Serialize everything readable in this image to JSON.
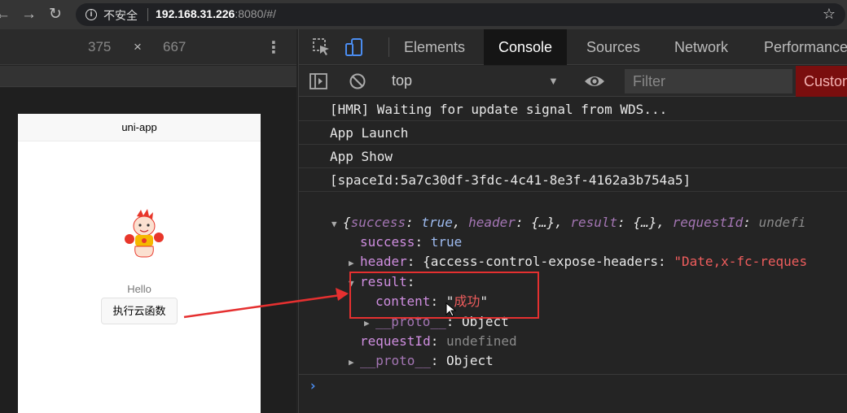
{
  "browser": {
    "back_icon": "back-arrow-icon",
    "forward_icon": "forward-arrow-icon",
    "reload_icon": "reload-icon",
    "security_label": "不安全",
    "url_host": "192.168.31.226",
    "url_rest": ":8080/#/",
    "bookmark_icon": "star-icon"
  },
  "device_toolbar": {
    "width": "375",
    "times": "×",
    "height": "667"
  },
  "phone": {
    "nav_title": "uni-app",
    "hello_text": "Hello",
    "button_label": "执行云函数"
  },
  "devtools": {
    "tabs": [
      "Elements",
      "Console",
      "Sources",
      "Network",
      "Performance"
    ],
    "active_tab": "Console",
    "context": "top",
    "filter_placeholder": "Filter",
    "levels_label": "Custom levels"
  },
  "console": {
    "logs": [
      "[HMR] Waiting for update signal from WDS...",
      "App Launch",
      "App Show",
      "[spaceId:5a7c30df-3fdc-4c41-8e3f-4162a3b754a5]"
    ],
    "object_preview": {
      "success_key": "success",
      "success_val": "true",
      "header_key": "header",
      "header_val": "{…}",
      "result_key": "result",
      "result_val": "{…}",
      "requestId_key": "requestId",
      "requestId_val": "undefi"
    },
    "tree": {
      "success_key": "success",
      "success_val": "true",
      "header_key": "header",
      "header_preview": "{access-control-expose-headers: ",
      "header_preview_str": "\"Date,x-fc-reques",
      "result_key": "result",
      "content_key": "content",
      "content_val": "成功",
      "proto_key": "__proto__",
      "proto_val": "Object",
      "requestId_key": "requestId",
      "requestId_val": "undefined"
    }
  },
  "colors": {
    "accent": "#e53030",
    "active_tab_bg": "#151515",
    "string": "#ef5d5d",
    "key": "#cf8ee0",
    "boolean": "#9ebbf0"
  }
}
